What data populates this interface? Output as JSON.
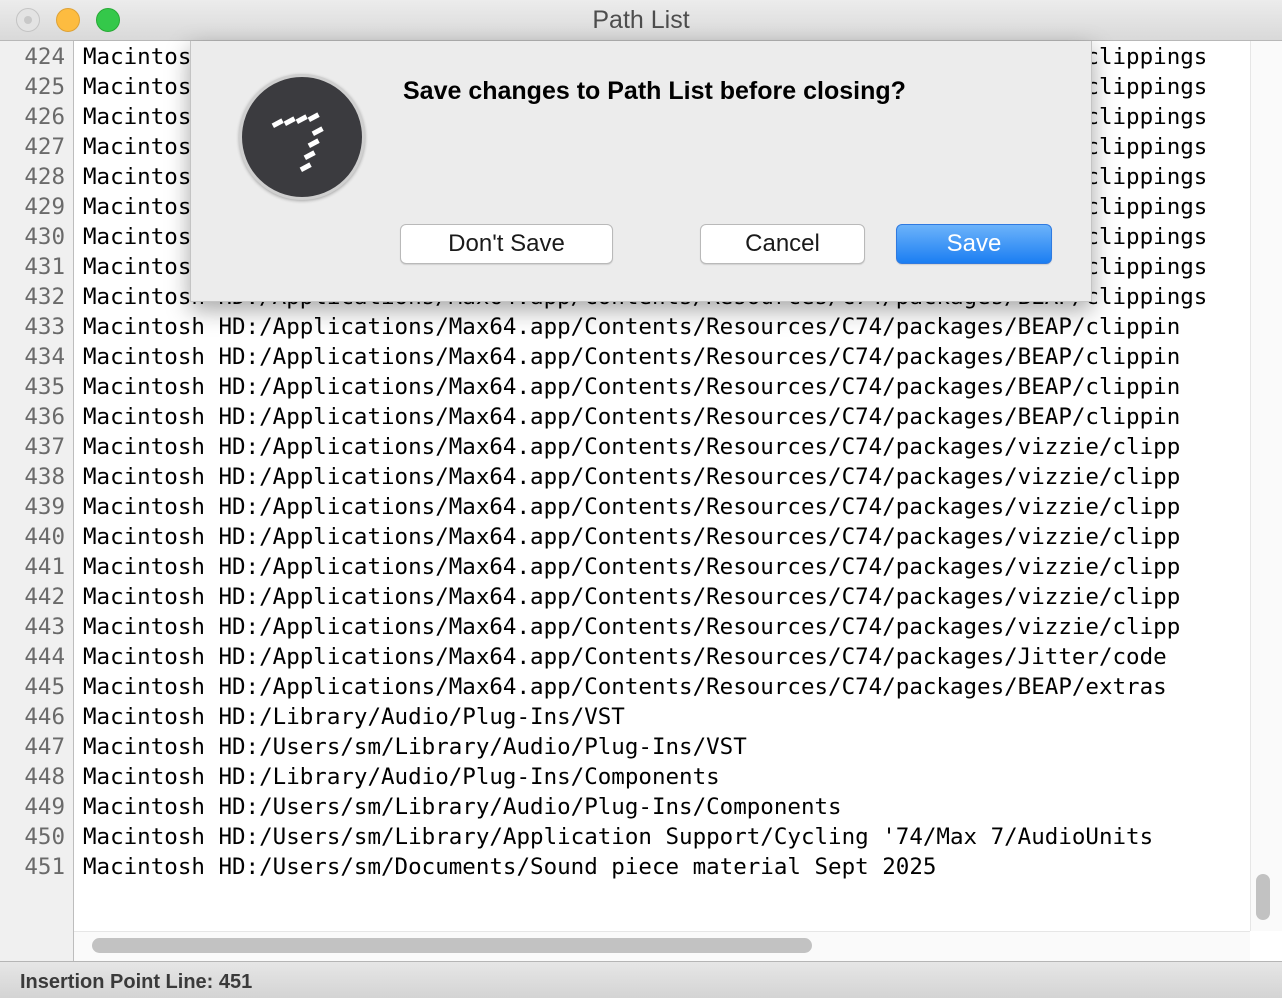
{
  "window": {
    "title": "Path List"
  },
  "editor": {
    "lines": [
      {
        "num": "424",
        "text": "Macintosh HD:/Applications/Max64.app/Contents/Resources/C74/packages/BEAP/clippings"
      },
      {
        "num": "425",
        "text": "Macintosh HD:/Applications/Max64.app/Contents/Resources/C74/packages/BEAP/clippings"
      },
      {
        "num": "426",
        "text": "Macintosh HD:/Applications/Max64.app/Contents/Resources/C74/packages/BEAP/clippings"
      },
      {
        "num": "427",
        "text": "Macintosh HD:/Applications/Max64.app/Contents/Resources/C74/packages/BEAP/clippings"
      },
      {
        "num": "428",
        "text": "Macintosh HD:/Applications/Max64.app/Contents/Resources/C74/packages/BEAP/clippings"
      },
      {
        "num": "429",
        "text": "Macintosh HD:/Applications/Max64.app/Contents/Resources/C74/packages/BEAP/clippings"
      },
      {
        "num": "430",
        "text": "Macintosh HD:/Applications/Max64.app/Contents/Resources/C74/packages/BEAP/clippings"
      },
      {
        "num": "431",
        "text": "Macintosh HD:/Applications/Max64.app/Contents/Resources/C74/packages/BEAP/clippings"
      },
      {
        "num": "432",
        "text": "Macintosh HD:/Applications/Max64.app/Contents/Resources/C74/packages/BEAP/clippings"
      },
      {
        "num": "433",
        "text": "Macintosh HD:/Applications/Max64.app/Contents/Resources/C74/packages/BEAP/clippin"
      },
      {
        "num": "434",
        "text": "Macintosh HD:/Applications/Max64.app/Contents/Resources/C74/packages/BEAP/clippin"
      },
      {
        "num": "435",
        "text": "Macintosh HD:/Applications/Max64.app/Contents/Resources/C74/packages/BEAP/clippin"
      },
      {
        "num": "436",
        "text": "Macintosh HD:/Applications/Max64.app/Contents/Resources/C74/packages/BEAP/clippin"
      },
      {
        "num": "437",
        "text": "Macintosh HD:/Applications/Max64.app/Contents/Resources/C74/packages/vizzie/clipp"
      },
      {
        "num": "438",
        "text": "Macintosh HD:/Applications/Max64.app/Contents/Resources/C74/packages/vizzie/clipp"
      },
      {
        "num": "439",
        "text": "Macintosh HD:/Applications/Max64.app/Contents/Resources/C74/packages/vizzie/clipp"
      },
      {
        "num": "440",
        "text": "Macintosh HD:/Applications/Max64.app/Contents/Resources/C74/packages/vizzie/clipp"
      },
      {
        "num": "441",
        "text": "Macintosh HD:/Applications/Max64.app/Contents/Resources/C74/packages/vizzie/clipp"
      },
      {
        "num": "442",
        "text": "Macintosh HD:/Applications/Max64.app/Contents/Resources/C74/packages/vizzie/clipp"
      },
      {
        "num": "443",
        "text": "Macintosh HD:/Applications/Max64.app/Contents/Resources/C74/packages/vizzie/clipp"
      },
      {
        "num": "444",
        "text": "Macintosh HD:/Applications/Max64.app/Contents/Resources/C74/packages/Jitter/code"
      },
      {
        "num": "445",
        "text": "Macintosh HD:/Applications/Max64.app/Contents/Resources/C74/packages/BEAP/extras"
      },
      {
        "num": "446",
        "text": "Macintosh HD:/Library/Audio/Plug-Ins/VST"
      },
      {
        "num": "447",
        "text": "Macintosh HD:/Users/sm/Library/Audio/Plug-Ins/VST"
      },
      {
        "num": "448",
        "text": "Macintosh HD:/Library/Audio/Plug-Ins/Components"
      },
      {
        "num": "449",
        "text": "Macintosh HD:/Users/sm/Library/Audio/Plug-Ins/Components"
      },
      {
        "num": "450",
        "text": "Macintosh HD:/Users/sm/Library/Application Support/Cycling '74/Max 7/AudioUnits"
      },
      {
        "num": "451",
        "text": "Macintosh HD:/Users/sm/Documents/Sound piece material Sept 2025"
      }
    ]
  },
  "status": {
    "text": "Insertion Point Line: 451"
  },
  "dialog": {
    "message": "Save changes to Path List before closing?",
    "dont_save_label": "Don't Save",
    "cancel_label": "Cancel",
    "save_label": "Save",
    "icon": "max-app-icon"
  },
  "colors": {
    "accent": "#1b7ef2",
    "title_text": "#4d4d4d"
  }
}
